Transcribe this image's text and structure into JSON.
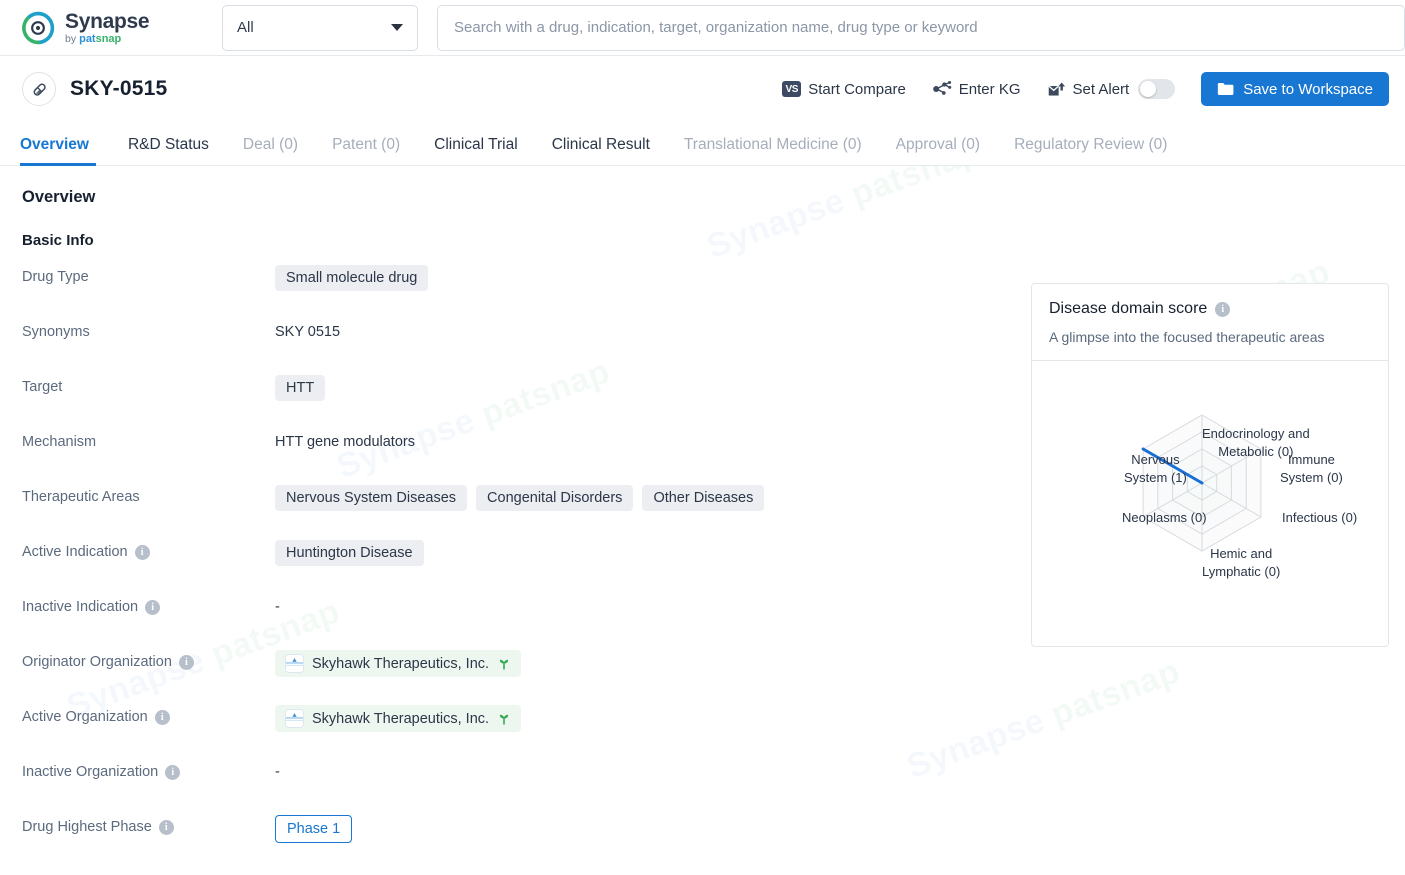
{
  "brand": {
    "name": "Synapse",
    "by": "by",
    "patsnap_pat": "pat",
    "patsnap_snap": "snap",
    "logo_icon": "synapse-logo-icon"
  },
  "search": {
    "scope_value": "All",
    "scope_caret_icon": "chevron-down-icon",
    "placeholder": "Search with a drug, indication, target, organization name, drug type or keyword",
    "value": ""
  },
  "drug_header": {
    "icon": "capsule-pill-icon",
    "title": "SKY-0515",
    "actions": [
      {
        "label": "Start Compare",
        "icon": "vs-badge-icon",
        "badge_text": "VS"
      },
      {
        "label": "Enter KG",
        "icon": "knowledge-graph-icon"
      },
      {
        "label": "Set Alert",
        "icon": "alert-envelope-icon",
        "toggle_on": false
      }
    ],
    "save_button": {
      "label": "Save to Workspace",
      "icon": "folder-icon"
    }
  },
  "tabs": [
    {
      "label": "Overview",
      "active": true,
      "dim": false
    },
    {
      "label": "R&D Status",
      "active": false,
      "dim": false
    },
    {
      "label": "Deal (0)",
      "active": false,
      "dim": true
    },
    {
      "label": "Patent (0)",
      "active": false,
      "dim": true
    },
    {
      "label": "Clinical Trial",
      "active": false,
      "dim": false
    },
    {
      "label": "Clinical Result",
      "active": false,
      "dim": false
    },
    {
      "label": "Translational Medicine (0)",
      "active": false,
      "dim": true
    },
    {
      "label": "Approval (0)",
      "active": false,
      "dim": true
    },
    {
      "label": "Regulatory Review (0)",
      "active": false,
      "dim": true
    }
  ],
  "overview": {
    "heading": "Overview",
    "basic_info_heading": "Basic Info",
    "rows": [
      {
        "label": "Drug Type",
        "info": false,
        "type": "chips",
        "values": [
          "Small molecule drug"
        ]
      },
      {
        "label": "Synonyms",
        "info": false,
        "type": "plain",
        "values": [
          "SKY 0515"
        ]
      },
      {
        "label": "Target",
        "info": false,
        "type": "chips",
        "values": [
          "HTT"
        ]
      },
      {
        "label": "Mechanism",
        "info": false,
        "type": "plain",
        "values": [
          "HTT gene modulators"
        ]
      },
      {
        "label": "Therapeutic Areas",
        "info": false,
        "type": "chips",
        "values": [
          "Nervous System Diseases",
          "Congenital Disorders",
          "Other Diseases"
        ]
      },
      {
        "label": "Active Indication",
        "info": true,
        "type": "chips",
        "values": [
          "Huntington Disease"
        ]
      },
      {
        "label": "Inactive Indication",
        "info": true,
        "type": "dash",
        "values": [
          "-"
        ]
      },
      {
        "label": "Originator Organization",
        "info": true,
        "type": "orgs",
        "values": [
          "Skyhawk Therapeutics, Inc."
        ]
      },
      {
        "label": "Active Organization",
        "info": true,
        "type": "orgs",
        "values": [
          "Skyhawk Therapeutics, Inc."
        ]
      },
      {
        "label": "Inactive Organization",
        "info": true,
        "type": "dash",
        "values": [
          "-"
        ]
      },
      {
        "label": "Drug Highest Phase",
        "info": true,
        "type": "phase",
        "values": [
          "Phase 1"
        ]
      }
    ]
  },
  "disease_panel": {
    "title": "Disease domain score",
    "info_icon": "info-icon",
    "subtitle": "A glimpse into the focused therapeutic areas"
  },
  "chart_data": {
    "type": "radar",
    "title": "Disease domain score",
    "subtitle": "A glimpse into the focused therapeutic areas",
    "categories": [
      "Endocrinology and Metabolic (0)",
      "Immune System (0)",
      "Infectious (0)",
      "Hemic and Lymphatic (0)",
      "Neoplasms (0)",
      "Nervous System (1)"
    ],
    "category_lines": [
      [
        "Endocrinology and",
        "Metabolic (0)"
      ],
      [
        "Immune",
        "System (0)"
      ],
      [
        "Infectious (0)"
      ],
      [
        "Hemic and",
        "Lymphatic (0)"
      ],
      [
        "Neoplasms (0)"
      ],
      [
        "Nervous",
        "System (1)"
      ]
    ],
    "series": [
      {
        "name": "Disease domain score",
        "values": [
          0,
          0,
          0,
          0,
          0,
          1
        ],
        "color": "#1a6fd4"
      }
    ],
    "rings": 4,
    "max": 1,
    "grid": true,
    "legend": "none",
    "grid_color": "#d7dade",
    "shape": "hexagon"
  },
  "watermark": {
    "text_blue": "Synapse",
    "text_sub_a": "by ",
    "text_sub_b": "patsnap"
  },
  "colors": {
    "accent": "#1777d2",
    "chip_bg": "#edeef1",
    "org_chip_bg": "#eef7ef",
    "green": "#35b36a",
    "text": "#1f2b3d",
    "muted": "#5c6a7e"
  }
}
